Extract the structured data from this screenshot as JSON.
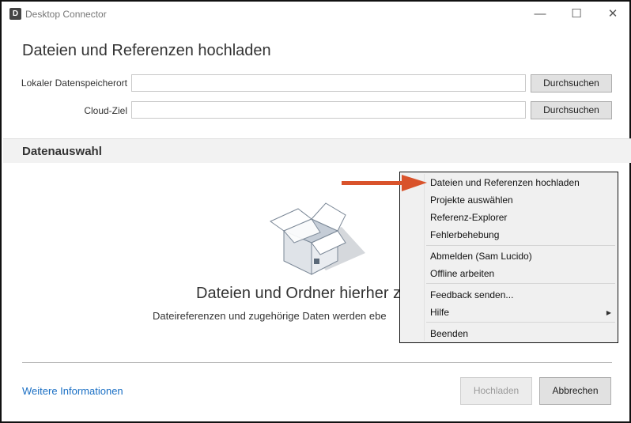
{
  "window": {
    "title": "Desktop Connector",
    "app_icon_letter": "D",
    "minimize": "—",
    "maximize": "☐",
    "close": "✕"
  },
  "page": {
    "title": "Dateien und Referenzen hochladen",
    "local_label": "Lokaler Datenspeicherort",
    "local_value": "",
    "browse1": "Durchsuchen",
    "cloud_label": "Cloud-Ziel",
    "cloud_value": "",
    "browse2": "Durchsuchen",
    "section": "Datenauswahl",
    "drop_title": "Dateien und Ordner hierher z",
    "drop_sub": "Dateireferenzen und zugehörige Daten werden ebe",
    "more_info": "Weitere Informationen",
    "upload": "Hochladen",
    "cancel": "Abbrechen"
  },
  "menu": {
    "items": [
      "Dateien und Referenzen hochladen",
      "Projekte auswählen",
      "Referenz-Explorer",
      "Fehlerbehebung",
      "Abmelden (Sam Lucido)",
      "Offline arbeiten",
      "Feedback senden...",
      "Hilfe",
      "Beenden"
    ],
    "submenu_arrow": "▶"
  },
  "colors": {
    "arrow": "#d9532b",
    "link": "#1a6fc4"
  }
}
